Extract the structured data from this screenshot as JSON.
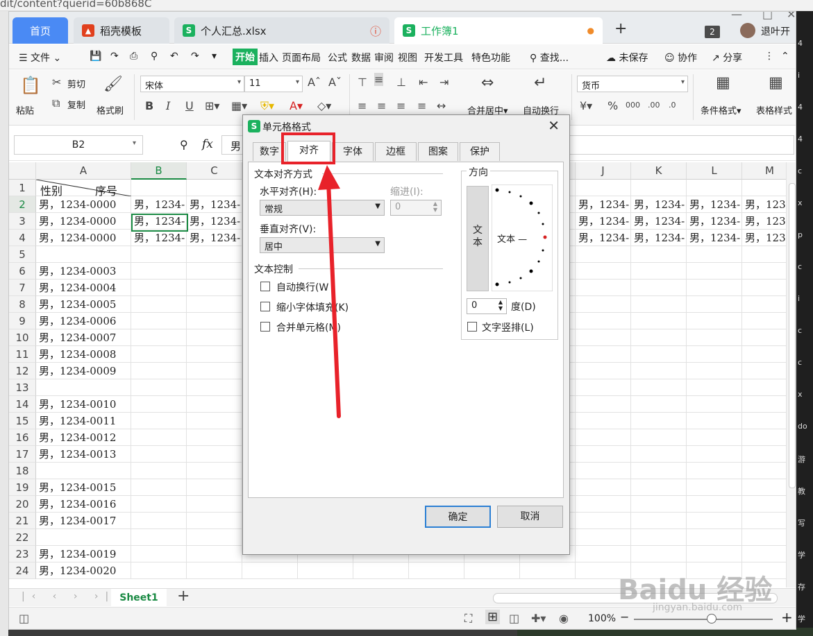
{
  "browser": {
    "url_fragment": "dit/content?querid=60b868C",
    "side_chars": [
      "4",
      "i",
      "4",
      "4",
      "c",
      "x",
      "p",
      "c",
      "i",
      "c",
      "c",
      "x",
      "do",
      "游",
      "教",
      "写",
      "学",
      "存",
      "学"
    ]
  },
  "tabs": {
    "home": "首页",
    "daoke": "稻壳模板",
    "personal": "个人汇总.xlsx",
    "workbook": "工作簿1",
    "new_tab": "+"
  },
  "titlebar": {
    "badge": "2",
    "logout": "退叶开"
  },
  "menu": {
    "file": "文件",
    "items": [
      "开始",
      "插入",
      "页面布局",
      "公式",
      "数据",
      "审阅",
      "视图",
      "开发工具",
      "特色功能"
    ],
    "search": "查找...",
    "unsaved": "未保存",
    "collab": "协作",
    "share": "分享"
  },
  "ribbon": {
    "paste": "粘贴",
    "cut": "剪切",
    "copy": "复制",
    "format_painter": "格式刷",
    "font_name": "宋体",
    "font_size": "11",
    "merge_center": "合并居中",
    "wrap_text": "自动换行",
    "number_format": "货币",
    "cond_format": "条件格式",
    "table_style": "表格样式"
  },
  "formula_bar": {
    "name_box": "B2",
    "fx": "fx",
    "content": "男"
  },
  "grid": {
    "columns": [
      "A",
      "B",
      "C",
      "",
      "",
      "",
      "",
      "",
      "",
      "J",
      "K",
      "L",
      "M"
    ],
    "selected_column": "B",
    "selected_row": "2",
    "a1_left": "性别",
    "a1_right": "序号",
    "rows": [
      {
        "n": "1",
        "a": "",
        "fill": false
      },
      {
        "n": "2",
        "a": "男，1234-0000",
        "fill": true
      },
      {
        "n": "3",
        "a": "男，1234-0000",
        "fill": true
      },
      {
        "n": "4",
        "a": "男，1234-0000",
        "fill": true
      },
      {
        "n": "5",
        "a": "",
        "fill": false
      },
      {
        "n": "6",
        "a": "男，1234-0003",
        "fill": false
      },
      {
        "n": "7",
        "a": "男，1234-0004",
        "fill": false
      },
      {
        "n": "8",
        "a": "男，1234-0005",
        "fill": false
      },
      {
        "n": "9",
        "a": "男，1234-0006",
        "fill": false
      },
      {
        "n": "10",
        "a": "男，1234-0007",
        "fill": false
      },
      {
        "n": "11",
        "a": "男，1234-0008",
        "fill": false
      },
      {
        "n": "12",
        "a": "男，1234-0009",
        "fill": false
      },
      {
        "n": "13",
        "a": "",
        "fill": false
      },
      {
        "n": "14",
        "a": "男，1234-0010",
        "fill": false
      },
      {
        "n": "15",
        "a": "男，1234-0011",
        "fill": false
      },
      {
        "n": "16",
        "a": "男，1234-0012",
        "fill": false
      },
      {
        "n": "17",
        "a": "男，1234-0013",
        "fill": false
      },
      {
        "n": "18",
        "a": "",
        "fill": false
      },
      {
        "n": "19",
        "a": "男，1234-0015",
        "fill": false
      },
      {
        "n": "20",
        "a": "男，1234-0016",
        "fill": false
      },
      {
        "n": "21",
        "a": "男，1234-0017",
        "fill": false
      },
      {
        "n": "22",
        "a": "",
        "fill": false
      },
      {
        "n": "23",
        "a": "男，1234-0019",
        "fill": false
      },
      {
        "n": "24",
        "a": "男，1234-0020",
        "fill": false
      }
    ],
    "truncated_value": "男，1234-"
  },
  "sheets": {
    "active": "Sheet1",
    "add": "+"
  },
  "status": {
    "zoom": "100%"
  },
  "dialog": {
    "title": "单元格格式",
    "tabs": [
      "数字",
      "对齐",
      "字体",
      "边框",
      "图案",
      "保护"
    ],
    "active_tab": "对齐",
    "text_align_group": "文本对齐方式",
    "horizontal_label": "水平对齐(H):",
    "horizontal_value": "常规",
    "indent_label": "缩进(I):",
    "indent_value": "0",
    "vertical_label": "垂直对齐(V):",
    "vertical_value": "居中",
    "text_control_group": "文本控制",
    "wrap_text": "自动换行(W",
    "shrink_to_fit": "缩小字体填充(K)",
    "merge_cells": "合并单元格(M)",
    "orientation_group": "方向",
    "vertical_text": "文\n本",
    "dial_text": "文本 —",
    "degrees_value": "0",
    "degrees_label": "度(D)",
    "vertical_layout": "文字竖排(L)",
    "ok": "确定",
    "cancel": "取消"
  },
  "watermark": {
    "brand": "Baidu 经验",
    "url": "jingyan.baidu.com"
  },
  "colors": {
    "accent_green": "#1a8a43",
    "wps_blue": "#4a8af4",
    "highlight_red": "#e8222a"
  }
}
